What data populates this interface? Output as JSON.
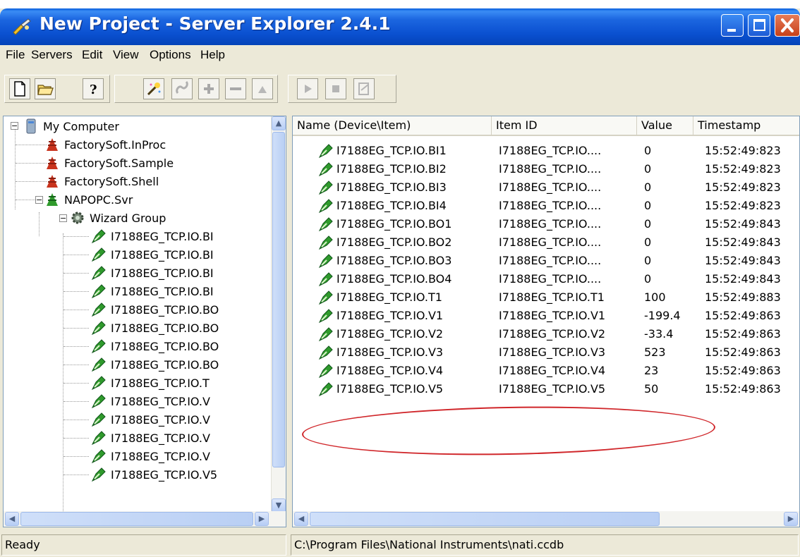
{
  "window": {
    "title": "New Project - Server Explorer 2.4.1"
  },
  "menu": [
    "File",
    "Servers",
    "Edit",
    "View",
    "Options",
    "Help"
  ],
  "toolbar": {
    "buttons": [
      "new-icon",
      "open-icon",
      "help-icon",
      "wizard-icon",
      "connect-icon",
      "add-icon",
      "remove-icon",
      "up-icon",
      "play-icon",
      "stop-icon",
      "write-icon"
    ]
  },
  "tree": {
    "root": "My Computer",
    "servers": [
      "FactorySoft.InProc",
      "FactorySoft.Sample",
      "FactorySoft.Shell",
      "NAPOPC.Svr"
    ],
    "group": "Wizard Group",
    "items": [
      "I7188EG_TCP.IO.BI",
      "I7188EG_TCP.IO.BI",
      "I7188EG_TCP.IO.BI",
      "I7188EG_TCP.IO.BI",
      "I7188EG_TCP.IO.BO",
      "I7188EG_TCP.IO.BO",
      "I7188EG_TCP.IO.BO",
      "I7188EG_TCP.IO.BO",
      "I7188EG_TCP.IO.T",
      "I7188EG_TCP.IO.V",
      "I7188EG_TCP.IO.V",
      "I7188EG_TCP.IO.V",
      "I7188EG_TCP.IO.V",
      "I7188EG_TCP.IO.V5"
    ]
  },
  "list": {
    "columns": [
      "Name (Device\\Item)",
      "Item ID",
      "Value",
      "Timestamp"
    ],
    "rows": [
      {
        "name": "I7188EG_TCP.IO.BI1",
        "id": "I7188EG_TCP.IO....",
        "value": "0",
        "time": "15:52:49:823"
      },
      {
        "name": "I7188EG_TCP.IO.BI2",
        "id": "I7188EG_TCP.IO....",
        "value": "0",
        "time": "15:52:49:823"
      },
      {
        "name": "I7188EG_TCP.IO.BI3",
        "id": "I7188EG_TCP.IO....",
        "value": "0",
        "time": "15:52:49:823"
      },
      {
        "name": "I7188EG_TCP.IO.BI4",
        "id": "I7188EG_TCP.IO....",
        "value": "0",
        "time": "15:52:49:823"
      },
      {
        "name": "I7188EG_TCP.IO.BO1",
        "id": "I7188EG_TCP.IO....",
        "value": "0",
        "time": "15:52:49:843"
      },
      {
        "name": "I7188EG_TCP.IO.BO2",
        "id": "I7188EG_TCP.IO....",
        "value": "0",
        "time": "15:52:49:843"
      },
      {
        "name": "I7188EG_TCP.IO.BO3",
        "id": "I7188EG_TCP.IO....",
        "value": "0",
        "time": "15:52:49:843"
      },
      {
        "name": "I7188EG_TCP.IO.BO4",
        "id": "I7188EG_TCP.IO....",
        "value": "0",
        "time": "15:52:49:843"
      },
      {
        "name": "I7188EG_TCP.IO.T1",
        "id": "I7188EG_TCP.IO.T1",
        "value": "100",
        "time": "15:52:49:883"
      },
      {
        "name": "I7188EG_TCP.IO.V1",
        "id": "I7188EG_TCP.IO.V1",
        "value": "-199.4",
        "time": "15:52:49:863"
      },
      {
        "name": "I7188EG_TCP.IO.V2",
        "id": "I7188EG_TCP.IO.V2",
        "value": "-33.4",
        "time": "15:52:49:863"
      },
      {
        "name": "I7188EG_TCP.IO.V3",
        "id": "I7188EG_TCP.IO.V3",
        "value": "523",
        "time": "15:52:49:863"
      },
      {
        "name": "I7188EG_TCP.IO.V4",
        "id": "I7188EG_TCP.IO.V4",
        "value": "23",
        "time": "15:52:49:863"
      },
      {
        "name": "I7188EG_TCP.IO.V5",
        "id": "I7188EG_TCP.IO.V5",
        "value": "50",
        "time": "15:52:49:863"
      }
    ]
  },
  "status": {
    "left": "Ready",
    "right": "C:\\Program Files\\National Instruments\\nati.ccdb"
  },
  "colors": {
    "title_bar": "#0a50d0",
    "window_bg": "#ece9d8",
    "highlight_ellipse": "#d0262a",
    "item_icon": "#2f9a2c",
    "server_icon": "#c9331d"
  }
}
